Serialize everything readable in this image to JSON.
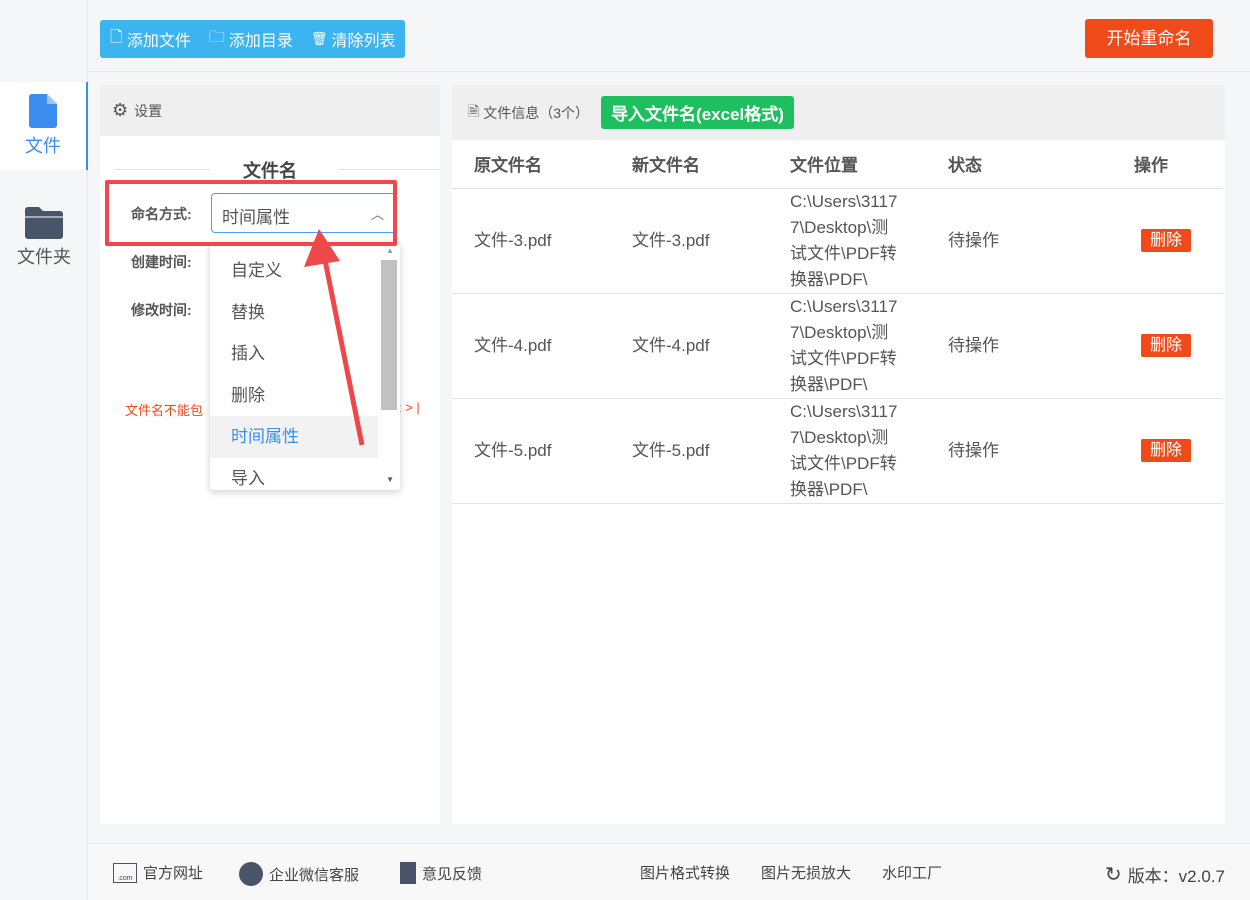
{
  "sidebar": {
    "items": [
      {
        "label": "文件",
        "active": true,
        "icon": "file-icon"
      },
      {
        "label": "文件夹",
        "active": false,
        "icon": "folder-icon"
      }
    ]
  },
  "toolbar": {
    "add_file": "添加文件",
    "add_dir": "添加目录",
    "clear_list": "清除列表",
    "start": "开始重命名"
  },
  "settings": {
    "title": "设置",
    "section": "文件名",
    "naming_label": "命名方式:",
    "naming_value": "时间属性",
    "create_time_label": "创建时间:",
    "modify_time_label": "修改时间:",
    "warning_start": "文件名不能包",
    "warning_end": ": > |",
    "options": [
      "自定义",
      "替换",
      "插入",
      "删除",
      "时间属性",
      "导入"
    ],
    "selected_option": "时间属性"
  },
  "fileinfo": {
    "title": "文件信息（3个）",
    "import_btn": "导入文件名(excel格式)",
    "columns": [
      "原文件名",
      "新文件名",
      "文件位置",
      "状态",
      "操作"
    ],
    "rows": [
      {
        "orig": "文件-3.pdf",
        "new": "文件-3.pdf",
        "path": "C:\\Users\\31177\\Desktop\\测试文件\\PDF转换器\\PDF\\",
        "status": "待操作",
        "action": "删除"
      },
      {
        "orig": "文件-4.pdf",
        "new": "文件-4.pdf",
        "path": "C:\\Users\\31177\\Desktop\\测试文件\\PDF转换器\\PDF\\",
        "status": "待操作",
        "action": "删除"
      },
      {
        "orig": "文件-5.pdf",
        "new": "文件-5.pdf",
        "path": "C:\\Users\\31177\\Desktop\\测试文件\\PDF转换器\\PDF\\",
        "status": "待操作",
        "action": "删除"
      }
    ]
  },
  "footer": {
    "website": "官方网址",
    "wechat": "企业微信客服",
    "feedback": "意见反馈",
    "link1": "图片格式转换",
    "link2": "图片无损放大",
    "link3": "水印工厂",
    "version": "版本：v2.0.7"
  },
  "colors": {
    "accent": "#3c8df0",
    "toolbar": "#3cb4f0",
    "danger": "#f04a1a",
    "import": "#1dbf5e",
    "annotation": "#f0474b"
  }
}
